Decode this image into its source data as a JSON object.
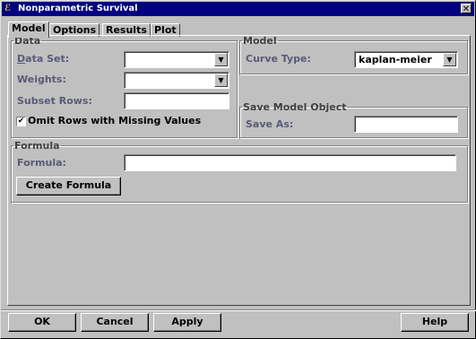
{
  "window": {
    "title": "Nonparametric Survival",
    "close_glyph": "✕",
    "icon": "app-icon"
  },
  "tabs": [
    {
      "label": "Model"
    },
    {
      "label": "Options"
    },
    {
      "label": "Results"
    },
    {
      "label": "Plot"
    }
  ],
  "data_group": {
    "legend": "Data",
    "data_set_label": "Data Set:",
    "data_set_value": "",
    "weights_label": "Weights:",
    "weights_value": "",
    "subset_rows_label": "Subset Rows:",
    "subset_rows_value": "",
    "omit_rows_label": "Omit Rows with Missing Values",
    "omit_rows_checked": true
  },
  "model_group": {
    "legend": "Model",
    "curve_type_label": "Curve Type:",
    "curve_type_value": "kaplan-meier"
  },
  "save_group": {
    "legend": "Save Model Object",
    "save_as_label": "Save As:",
    "save_as_value": ""
  },
  "formula_group": {
    "legend": "Formula",
    "formula_label": "Formula:",
    "formula_value": "",
    "create_formula_label": "Create Formula"
  },
  "buttons": {
    "ok": "OK",
    "cancel": "Cancel",
    "apply": "Apply",
    "help": "Help"
  }
}
